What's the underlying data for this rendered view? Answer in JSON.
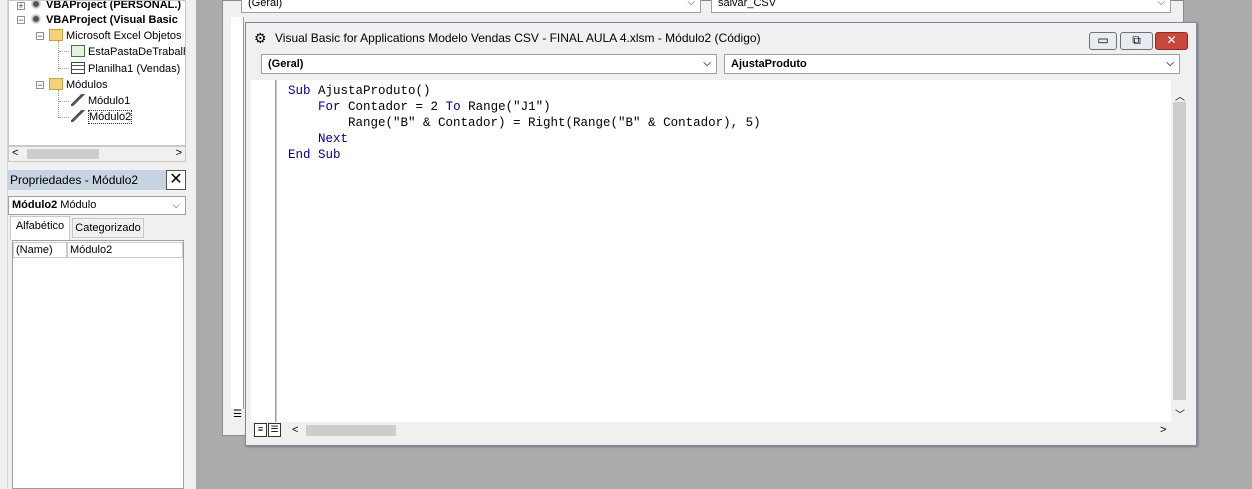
{
  "project_tree": {
    "items": [
      {
        "label": "VBAProject (PERSONAL.)",
        "bold": true
      },
      {
        "label": "VBAProject (Visual Basic",
        "bold": true
      },
      {
        "label": "Microsoft Excel Objetos",
        "bold": false
      },
      {
        "label": "EstaPastaDeTrabalh",
        "bold": false
      },
      {
        "label": "Planilha1 (Vendas)",
        "bold": false
      },
      {
        "label": "Módulos",
        "bold": false
      },
      {
        "label": "Módulo1",
        "bold": false
      },
      {
        "label": "Módulo2",
        "bold": false
      }
    ]
  },
  "properties": {
    "title": "Propriedades - Módulo2",
    "close": "✕",
    "object_name": "Módulo2",
    "object_type": "Módulo",
    "tabs": [
      "Alfabético",
      "Categorizado"
    ],
    "rows": [
      {
        "name": "(Name)",
        "value": "Módulo2"
      }
    ]
  },
  "bg_window": {
    "object_combo": "(Geral)",
    "proc_combo": "salvar_CSV"
  },
  "code_window": {
    "title": "Visual Basic for Applications Modelo Vendas CSV - FINAL AULA 4.xlsm - Módulo2 (Código)",
    "object_combo": "(Geral)",
    "proc_combo": "AjustaProduto",
    "lines": [
      {
        "kw1": "Sub",
        "rest": " AjustaProduto()"
      },
      {
        "indent": "    ",
        "kw1": "For",
        "mid": " Contador = 2 ",
        "kw2": "To",
        "rest": " Range(\"J1\")"
      },
      {
        "indent": "        ",
        "rest": "Range(\"B\" & Contador) = Right(Range(\"B\" & Contador), 5)"
      },
      {
        "indent": "    ",
        "kw1": "Next"
      },
      {
        "kw1": "End",
        "mid": " ",
        "kw2": "Sub"
      }
    ]
  },
  "colors": {
    "keyword": "#00008b",
    "props_title_bg": "#c6d3e0"
  }
}
